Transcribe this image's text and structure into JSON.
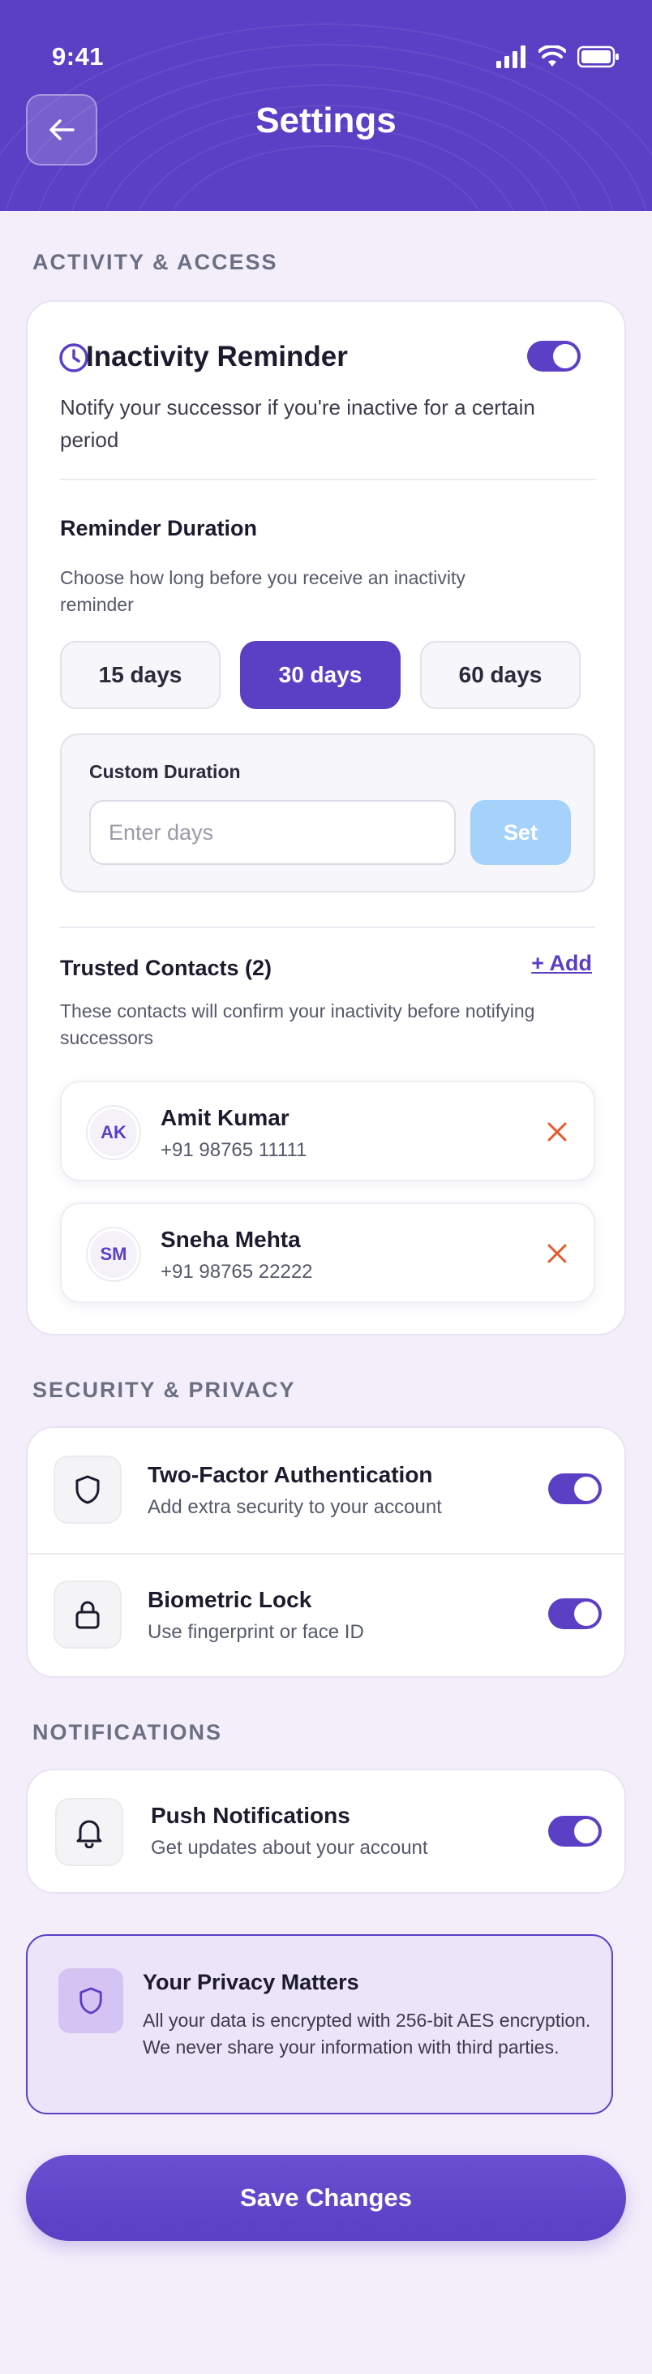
{
  "status_bar": {
    "time": "9:41"
  },
  "header": {
    "title": "Settings"
  },
  "sections": {
    "activity": "ACTIVITY & ACCESS",
    "security": "SECURITY & PRIVACY",
    "notifications": "NOTIFICATIONS"
  },
  "inactivity": {
    "title": "Inactivity Reminder",
    "description": "Notify your successor if you're inactive for a certain period",
    "enabled": true
  },
  "reminder_duration": {
    "title": "Reminder Duration",
    "description": "Choose how long before you receive an inactivity reminder",
    "options": [
      "15 days",
      "30 days",
      "60 days"
    ],
    "selected": "30 days"
  },
  "custom_duration": {
    "label": "Custom Duration",
    "placeholder": "Enter days",
    "set_label": "Set"
  },
  "trusted_contacts": {
    "title": "Trusted Contacts (2)",
    "add_label": "+ Add",
    "description": "These contacts will confirm your inactivity before notifying successors",
    "contacts": [
      {
        "initials": "AK",
        "name": "Amit Kumar",
        "phone": "+91 98765 11111"
      },
      {
        "initials": "SM",
        "name": "Sneha Mehta",
        "phone": "+91 98765 22222"
      }
    ]
  },
  "security": {
    "two_factor": {
      "title": "Two-Factor Authentication",
      "description": "Add extra security to your account",
      "enabled": true
    },
    "biometric": {
      "title": "Biometric Lock",
      "description": "Use fingerprint or face ID",
      "enabled": true
    }
  },
  "notifications": {
    "push": {
      "title": "Push Notifications",
      "description": "Get updates about your account",
      "enabled": true
    }
  },
  "privacy": {
    "title": "Your Privacy Matters",
    "text": "All your data is encrypted with 256-bit AES encryption. We never share your information with third parties."
  },
  "save_label": "Save Changes",
  "colors": {
    "accent": "#5b3fc4",
    "background": "#f4eefb",
    "set_button": "#a5d2fb",
    "remove": "#e8582c"
  }
}
